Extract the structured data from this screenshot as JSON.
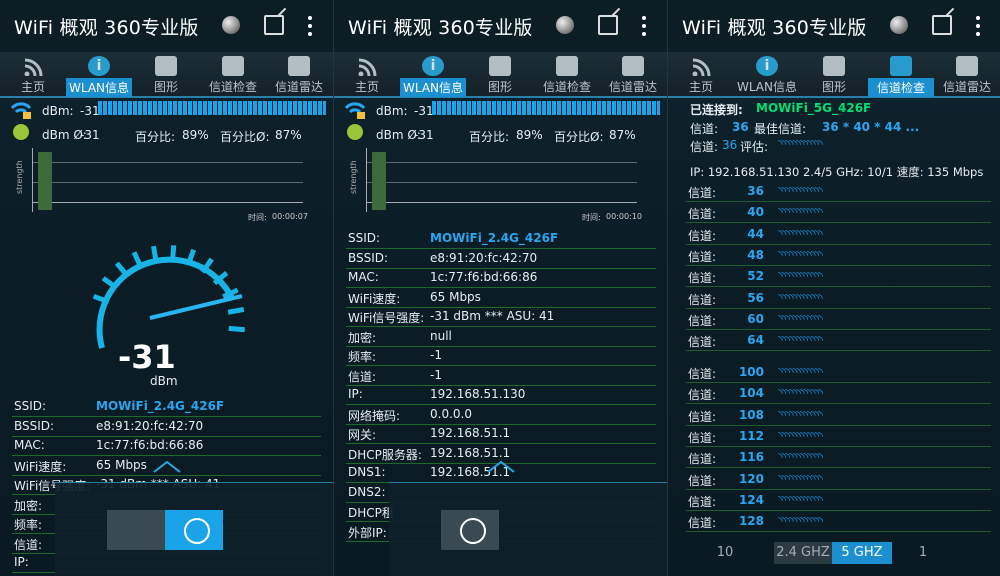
{
  "app_title": "WiFi 概观 360专业版",
  "tabs": [
    "主页",
    "WLAN信息",
    "图形",
    "信道检查",
    "信道雷达"
  ],
  "colors": {
    "accent": "#1aa3e8",
    "green": "#00e070",
    "bg": "#0b1a22"
  },
  "signal": {
    "dbm_label": "dBm:",
    "dbm_value": "-31",
    "avg_label": "dBm Ø:",
    "avg_value": "-31",
    "pct_label": "百分比:",
    "pct_value": "89%",
    "pct_avg_label": "百分比Ø:",
    "pct_avg_value": "87%"
  },
  "graph1": {
    "ylabel": "strength",
    "time_label": "时间:",
    "time_value": "00:00:07"
  },
  "graph2": {
    "ylabel": "strength",
    "time_label": "时间:",
    "time_value": "00:00:10"
  },
  "gauge": {
    "value": "-31",
    "unit": "dBm"
  },
  "info_rows_p1": [
    {
      "k": "SSID:",
      "v": "MOWiFi_2.4G_426F",
      "hl": true
    },
    {
      "k": "BSSID:",
      "v": "e8:91:20:fc:42:70"
    },
    {
      "k": "MAC:",
      "v": "1c:77:f6:bd:66:86"
    },
    {
      "k": "WiFi速度:",
      "v": "65 Mbps"
    },
    {
      "k": "WiFi信号强度:",
      "v": "-31 dBm *** ASU: 41"
    },
    {
      "k": "加密:",
      "v": ""
    },
    {
      "k": "频率:",
      "v": ""
    },
    {
      "k": "信道:",
      "v": ""
    },
    {
      "k": "IP:",
      "v": ""
    }
  ],
  "info_rows_p2": [
    {
      "k": "SSID:",
      "v": "MOWiFi_2.4G_426F",
      "hl": true
    },
    {
      "k": "BSSID:",
      "v": "e8:91:20:fc:42:70"
    },
    {
      "k": "MAC:",
      "v": "1c:77:f6:bd:66:86"
    },
    {
      "k": "WiFi速度:",
      "v": "65 Mbps"
    },
    {
      "k": "WiFi信号强度:",
      "v": "-31 dBm *** ASU: 41"
    },
    {
      "k": "加密:",
      "v": "null"
    },
    {
      "k": "频率:",
      "v": "-1"
    },
    {
      "k": "信道:",
      "v": "-1"
    },
    {
      "k": "IP:",
      "v": "192.168.51.130"
    },
    {
      "k": "网络掩码:",
      "v": "0.0.0.0"
    },
    {
      "k": "网关:",
      "v": "192.168.51.1"
    },
    {
      "k": "DHCP服务器:",
      "v": "192.168.51.1"
    },
    {
      "k": "DNS1:",
      "v": "192.168.51.1"
    },
    {
      "k": "DNS2:",
      "v": ""
    },
    {
      "k": "DHCP租",
      "v": ""
    },
    {
      "k": "外部IP:",
      "v": ""
    }
  ],
  "channel_check": {
    "connected_label": "已连接到:",
    "connected_ssid": "MOWiFi_5G_426F",
    "channel_label": "信道:",
    "channel_value": "36",
    "best_label": "最佳信道:",
    "best_value": "36 * 40 * 44 ...",
    "rating_channel": "36",
    "rating_label": "评估:",
    "ip_line": "IP: 192.168.51.130 2.4/5 GHz:   10/1     速度:   135 Mbps",
    "row_label": "信道:",
    "channels_a": [
      "36",
      "40",
      "44",
      "48",
      "52",
      "56",
      "60",
      "64"
    ],
    "channels_b": [
      "100",
      "104",
      "108",
      "112",
      "116",
      "120",
      "124",
      "128"
    ],
    "wave_glyphs": "◝◝◝◝◝◝◝◝◝◝◝◝"
  },
  "band_bar": {
    "left": "10",
    "b24": "2.4 GHZ",
    "b5": "5 GHZ",
    "right": "1"
  }
}
